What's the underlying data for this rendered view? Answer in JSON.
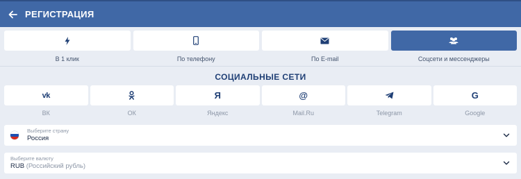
{
  "header": {
    "title": "РЕГИСТРАЦИЯ",
    "back_icon": "arrow-left-icon",
    "color": "#4068a6"
  },
  "methods": [
    {
      "label": "В 1 клик",
      "icon": "lightning-icon",
      "active": false
    },
    {
      "label": "По телефону",
      "icon": "phone-icon",
      "active": false
    },
    {
      "label": "По E-mail",
      "icon": "envelope-icon",
      "active": false
    },
    {
      "label": "Соцсети и мессенджеры",
      "icon": "users-icon",
      "active": true
    }
  ],
  "social_section": {
    "title": "СОЦИАЛЬНЫЕ СЕТИ",
    "items": [
      {
        "label": "ВК",
        "icon": "vk-icon"
      },
      {
        "label": "ОК",
        "icon": "odnoklassniki-icon"
      },
      {
        "label": "Яндекс",
        "icon": "yandex-icon"
      },
      {
        "label": "Mail.Ru",
        "icon": "mailru-icon"
      },
      {
        "label": "Telegram",
        "icon": "telegram-icon"
      },
      {
        "label": "Google",
        "icon": "google-icon"
      }
    ]
  },
  "country_field": {
    "label": "Выберите страну",
    "value": "Россия",
    "flag_icon": "russia-flag-icon"
  },
  "currency_field": {
    "label": "Выберите валюту",
    "code": "RUB",
    "name": "(Российский рубль)"
  },
  "icon_glyphs": {
    "vk": "vk",
    "yandex": "Я",
    "mailru": "@",
    "google": "G"
  }
}
